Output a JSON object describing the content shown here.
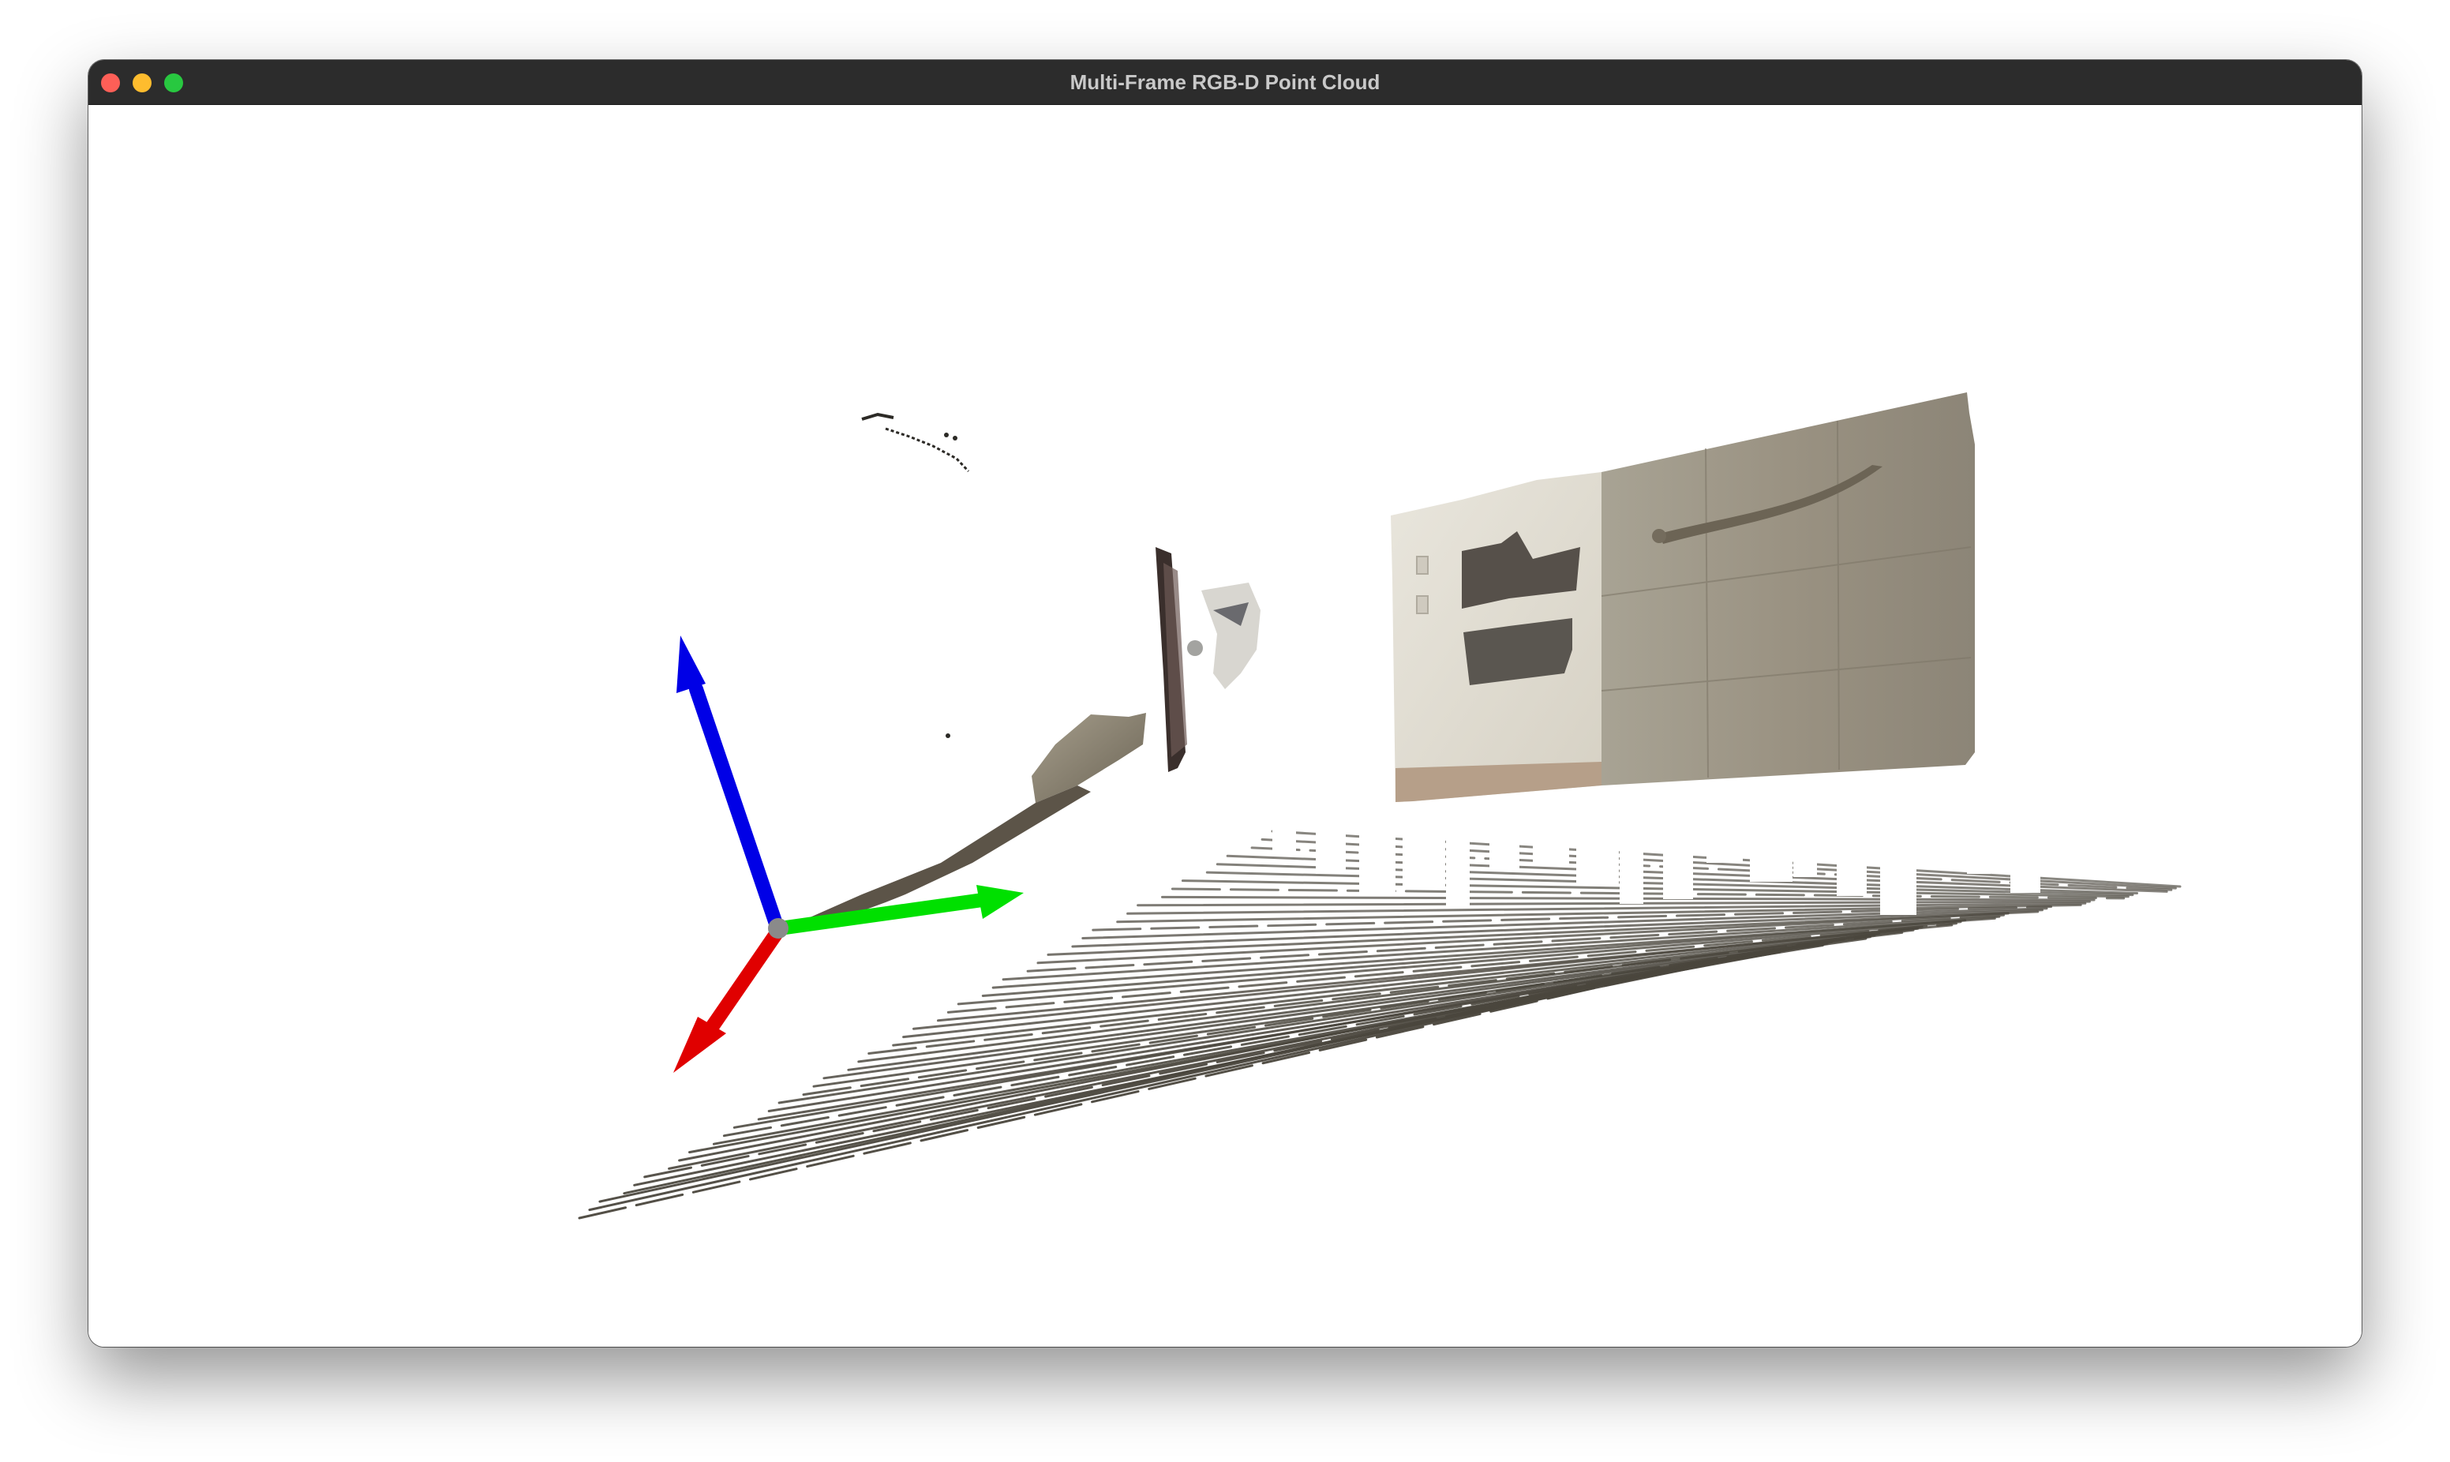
{
  "window": {
    "title": "Multi-Frame RGB-D Point Cloud",
    "controls": {
      "close": {
        "icon": "close-icon",
        "color": "#fe5f57"
      },
      "minimize": {
        "icon": "minimize-icon",
        "color": "#febc2e"
      },
      "zoom": {
        "icon": "zoom-icon",
        "color": "#28c840"
      }
    }
  },
  "viewport": {
    "background": "#ffffff",
    "axes": {
      "x": {
        "color": "#e00000"
      },
      "y": {
        "color": "#00e000"
      },
      "z": {
        "color": "#0000e6"
      },
      "origin": {
        "color": "#8a8a8a"
      }
    },
    "point_cloud": {
      "floor_color": "#4a463d",
      "wall_color": "#b4ae9e",
      "panel_color": "#e8e4da"
    }
  }
}
